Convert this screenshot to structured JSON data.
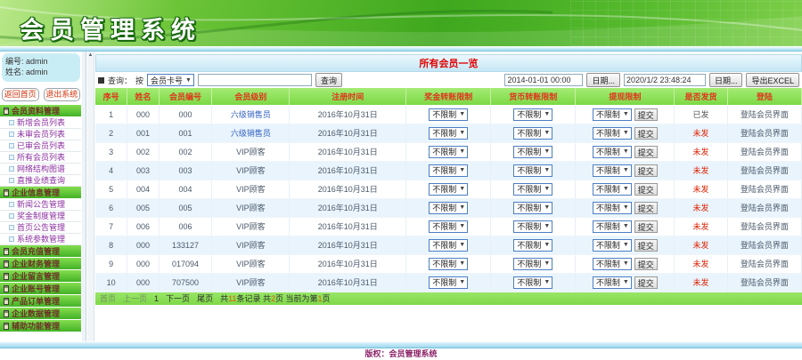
{
  "header": {
    "title": "会员管理系统"
  },
  "sidebar": {
    "user": {
      "id": "编号: admin",
      "name": "姓名: admin"
    },
    "home_button": "返回首页",
    "logout_button": "退出系统",
    "menu": [
      {
        "type": "section",
        "label": "会员资料管理"
      },
      {
        "type": "item",
        "label": "新增会员列表"
      },
      {
        "type": "item",
        "label": "未审会员列表"
      },
      {
        "type": "item",
        "label": "已审会员列表"
      },
      {
        "type": "item",
        "label": "所有会员列表"
      },
      {
        "type": "item",
        "label": "网络结构图谱"
      },
      {
        "type": "item",
        "label": "直推业绩查询"
      },
      {
        "type": "section",
        "label": "企业信息管理"
      },
      {
        "type": "item",
        "label": "新闻公告管理"
      },
      {
        "type": "item",
        "label": "奖金制度管理"
      },
      {
        "type": "item",
        "label": "首页公告管理"
      },
      {
        "type": "item",
        "label": "系统参数管理"
      },
      {
        "type": "section",
        "label": "会员充值管理"
      },
      {
        "type": "section",
        "label": "企业财务管理"
      },
      {
        "type": "section",
        "label": "企业留言管理"
      },
      {
        "type": "section",
        "label": "企业账号管理"
      },
      {
        "type": "section",
        "label": "产品订单管理"
      },
      {
        "type": "section",
        "label": "企业数据管理"
      },
      {
        "type": "section",
        "label": "辅助功能管理"
      }
    ]
  },
  "main": {
    "title": "所有会员一览"
  },
  "query": {
    "label": "查询：",
    "by_label": "按",
    "field_select": "会员卡号",
    "search_value": "",
    "search_button": "查询",
    "date_from": "2014-01-01 00:00",
    "date_from_button": "日期...",
    "date_to": "2020/1/2 23:48:24",
    "date_to_button": "日期...",
    "export_button": "导出EXCEL"
  },
  "table": {
    "columns": [
      "序号",
      "姓名",
      "会员编号",
      "会员级别",
      "注册时间",
      "奖金转账限制",
      "货币转账限制",
      "提现限制",
      "是否发货",
      "登陆"
    ],
    "dropdown_value": "不限制",
    "submit_label": "提交",
    "login_label": "登陆会员界面",
    "rows": [
      {
        "seq": "1",
        "name": "000",
        "member_no": "000",
        "level": "六级销售员",
        "level_is_link": true,
        "reg_time": "2016年10月31日",
        "delivery": "已发",
        "delivered": true
      },
      {
        "seq": "2",
        "name": "001",
        "member_no": "001",
        "level": "六级销售员",
        "level_is_link": true,
        "reg_time": "2016年10月31日",
        "delivery": "未发",
        "delivered": false
      },
      {
        "seq": "3",
        "name": "002",
        "member_no": "002",
        "level": "VIP顾客",
        "level_is_link": false,
        "reg_time": "2016年10月31日",
        "delivery": "未发",
        "delivered": false
      },
      {
        "seq": "4",
        "name": "003",
        "member_no": "003",
        "level": "VIP顾客",
        "level_is_link": false,
        "reg_time": "2016年10月31日",
        "delivery": "未发",
        "delivered": false
      },
      {
        "seq": "5",
        "name": "004",
        "member_no": "004",
        "level": "VIP顾客",
        "level_is_link": false,
        "reg_time": "2016年10月31日",
        "delivery": "未发",
        "delivered": false
      },
      {
        "seq": "6",
        "name": "005",
        "member_no": "005",
        "level": "VIP顾客",
        "level_is_link": false,
        "reg_time": "2016年10月31日",
        "delivery": "未发",
        "delivered": false
      },
      {
        "seq": "7",
        "name": "006",
        "member_no": "006",
        "level": "VIP顾客",
        "level_is_link": false,
        "reg_time": "2016年10月31日",
        "delivery": "未发",
        "delivered": false
      },
      {
        "seq": "8",
        "name": "000",
        "member_no": "133127",
        "level": "VIP顾客",
        "level_is_link": false,
        "reg_time": "2016年10月31日",
        "delivery": "未发",
        "delivered": false
      },
      {
        "seq": "9",
        "name": "000",
        "member_no": "017094",
        "level": "VIP顾客",
        "level_is_link": false,
        "reg_time": "2016年10月31日",
        "delivery": "未发",
        "delivered": false
      },
      {
        "seq": "10",
        "name": "000",
        "member_no": "707500",
        "level": "VIP顾客",
        "level_is_link": false,
        "reg_time": "2016年10月31日",
        "delivery": "未发",
        "delivered": false
      }
    ]
  },
  "pagination": {
    "links": [
      {
        "label": "首页",
        "muted": true
      },
      {
        "label": "上一页",
        "muted": true
      },
      {
        "label": "1",
        "muted": false
      },
      {
        "label": "下一页",
        "muted": false
      },
      {
        "label": "尾页",
        "muted": false
      }
    ],
    "info": [
      {
        "text": "共"
      },
      {
        "text": "11",
        "red": true
      },
      {
        "text": "条记录 共"
      },
      {
        "text": "2",
        "red": true
      },
      {
        "text": "页 当前为第"
      },
      {
        "text": "1",
        "red": true
      },
      {
        "text": "页"
      }
    ]
  },
  "footer": {
    "text": "版权：会员管理系统"
  },
  "colors": {
    "accent_green": "#44b226",
    "header_red": "#e0351c",
    "unsent_red": "#e02000"
  }
}
